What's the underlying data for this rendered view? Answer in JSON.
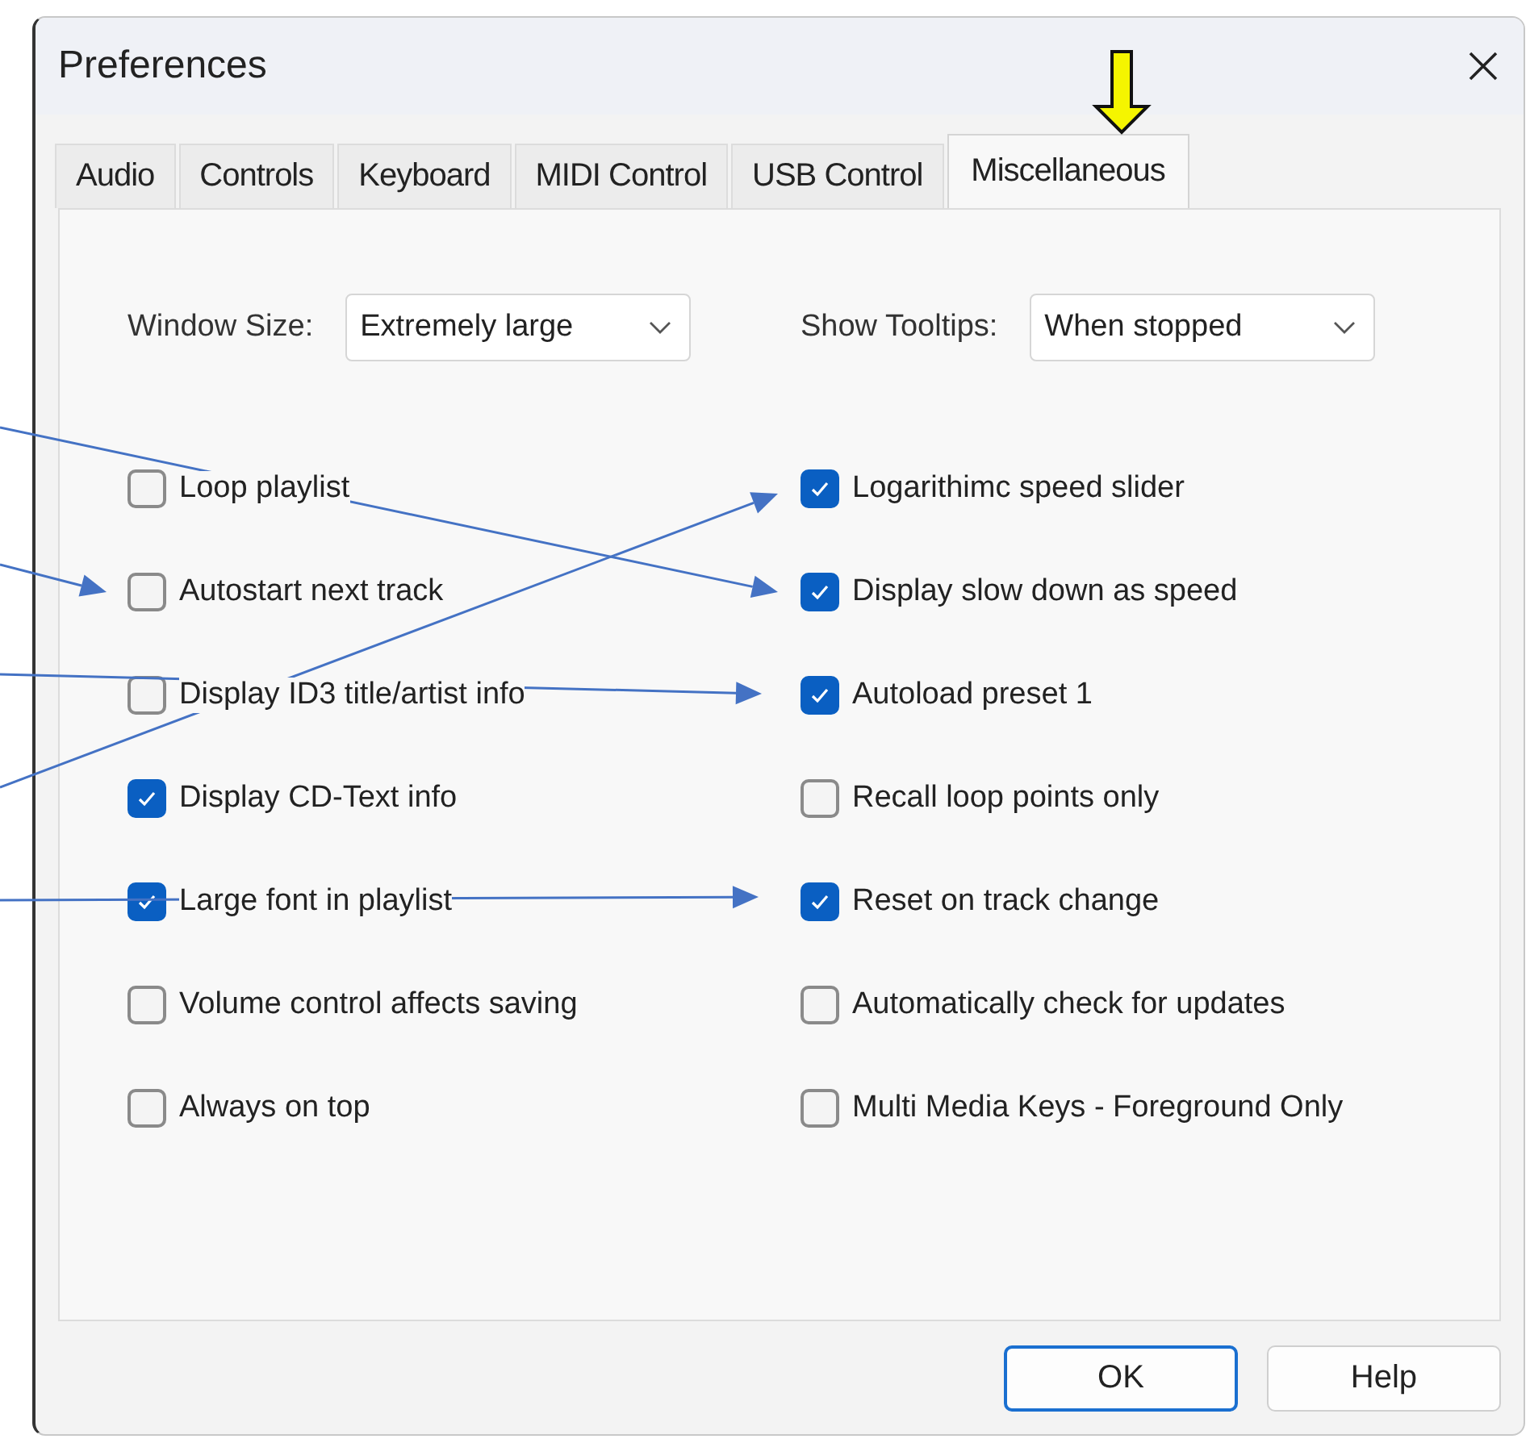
{
  "window": {
    "title": "Preferences"
  },
  "tabs": [
    {
      "label": "Audio",
      "selected": false
    },
    {
      "label": "Controls",
      "selected": false
    },
    {
      "label": "Keyboard",
      "selected": false
    },
    {
      "label": "MIDI Control",
      "selected": false
    },
    {
      "label": "USB Control",
      "selected": false
    },
    {
      "label": "Miscellaneous",
      "selected": true
    }
  ],
  "dropdowns": [
    {
      "label": "Window Size:",
      "value": "Extremely large"
    },
    {
      "label": "Show Tooltips:",
      "value": "When stopped"
    }
  ],
  "left_options": [
    {
      "label": "Loop playlist",
      "checked": false
    },
    {
      "label": "Autostart next track",
      "checked": false
    },
    {
      "label": "Display ID3 title/artist info",
      "checked": false
    },
    {
      "label": "Display CD-Text info",
      "checked": true
    },
    {
      "label": "Large font in playlist",
      "checked": true
    },
    {
      "label": "Volume control affects saving",
      "checked": false
    },
    {
      "label": "Always on top",
      "checked": false
    }
  ],
  "right_options": [
    {
      "label": "Logarithimc speed slider",
      "checked": true
    },
    {
      "label": "Display slow down as speed",
      "checked": true
    },
    {
      "label": "Autoload preset 1",
      "checked": true
    },
    {
      "label": "Recall loop points only",
      "checked": false
    },
    {
      "label": "Reset on track change",
      "checked": true
    },
    {
      "label": "Automatically check for updates",
      "checked": false
    },
    {
      "label": "Multi Media Keys - Foreground Only",
      "checked": false
    }
  ],
  "buttons": [
    {
      "label": "OK",
      "default": true
    },
    {
      "label": "Help",
      "default": false
    }
  ]
}
